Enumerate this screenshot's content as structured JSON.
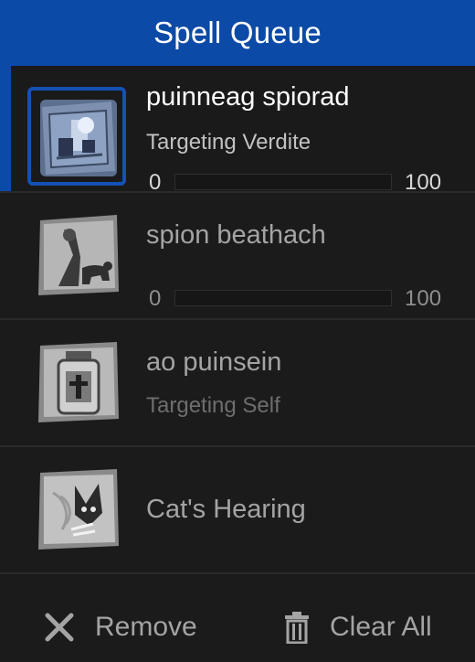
{
  "header": {
    "title": "Spell Queue"
  },
  "colors": {
    "accent": "#0b4aa6",
    "selected_text": "#ffffff",
    "dim_text": "#a4a4a4",
    "background": "#1b1b1b"
  },
  "queue": [
    {
      "name": "puinneag spiorad",
      "target": "Targeting Verdite",
      "progress": {
        "min": "0",
        "max": "100",
        "value": 0
      },
      "icon": "spirit-window-icon",
      "selected": true
    },
    {
      "name": "spion beathach",
      "progress": {
        "min": "0",
        "max": "100",
        "value": 0
      },
      "icon": "beast-spy-icon",
      "selected": false
    },
    {
      "name": "ao puinsein",
      "target": "Targeting Self",
      "icon": "antidote-jar-icon",
      "selected": false
    },
    {
      "name": "Cat's Hearing",
      "icon": "cat-hearing-icon",
      "selected": false
    }
  ],
  "footer": {
    "remove_label": "Remove",
    "clear_all_label": "Clear All",
    "remove_icon": "close-icon",
    "clear_icon": "trash-icon"
  }
}
